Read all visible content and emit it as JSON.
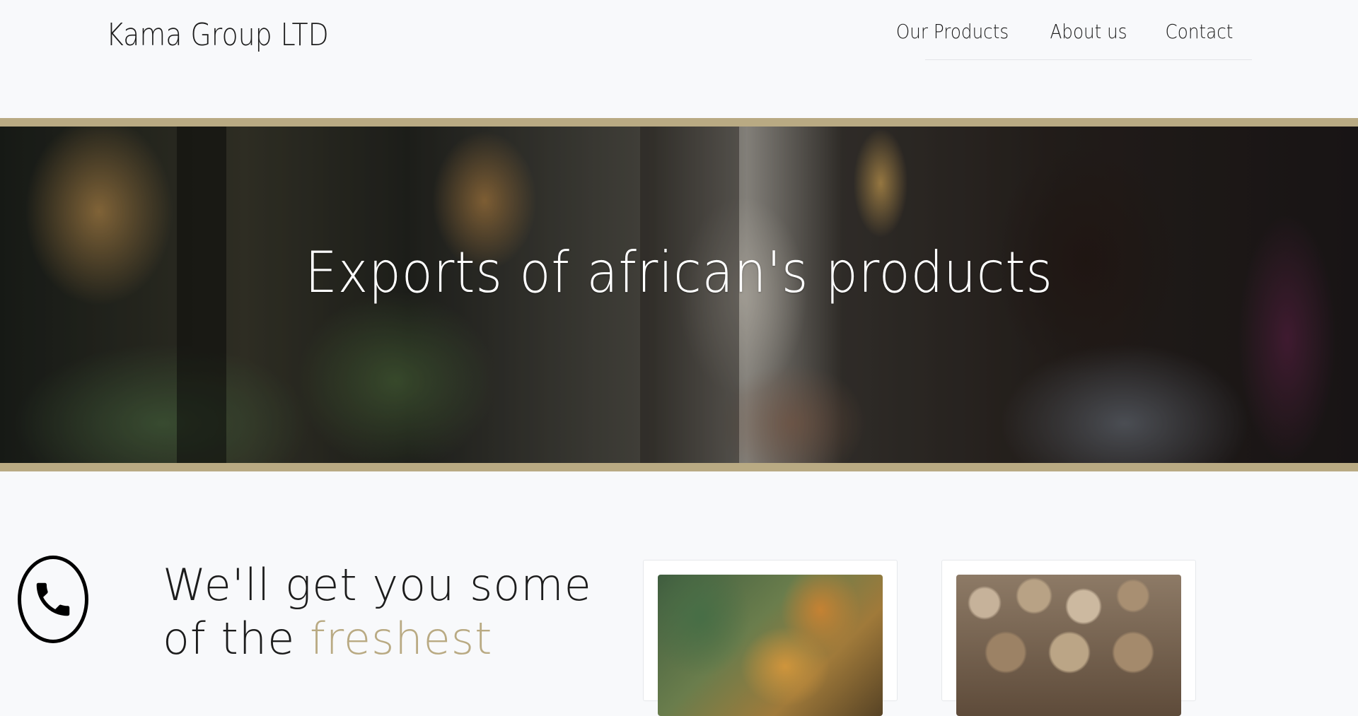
{
  "header": {
    "brand": "Kama Group LTD",
    "nav": [
      {
        "label": "Our Products"
      },
      {
        "label": "About us"
      },
      {
        "label": "Contact"
      }
    ]
  },
  "hero": {
    "title": "Exports of african's products"
  },
  "intro": {
    "headline_line1": "We'll get you some",
    "headline_line2_prefix": "of the ",
    "headline_accent": "freshest"
  },
  "cards": [
    {
      "image": "pineapple-photo"
    },
    {
      "image": "walnut-photo"
    }
  ],
  "icons": {
    "phone": "phone-icon"
  },
  "colors": {
    "accent": "#b9aa83",
    "background": "#f8f9fb",
    "text": "#1c1c1c"
  }
}
